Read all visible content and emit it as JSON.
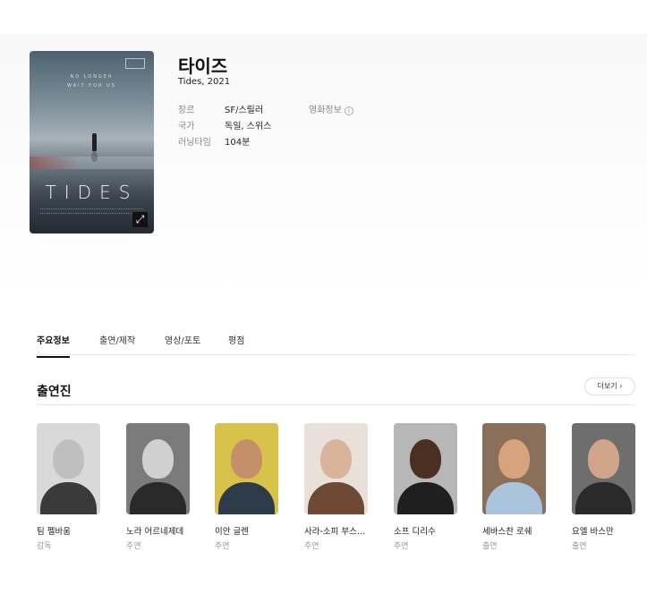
{
  "movie": {
    "title": "타이즈",
    "subtitle": "Tides, 2021",
    "poster": {
      "tagline_line1": "NO LONGER",
      "tagline_line2": "WAIT FOR US",
      "title_text": "TIDES",
      "expand_icon": "expand-icon"
    },
    "info": [
      {
        "key": "장르",
        "value": "SF/스릴러"
      },
      {
        "key": "국가",
        "value": "독일, 스위스"
      },
      {
        "key": "러닝타임",
        "value": "104분"
      }
    ],
    "more_info_label": "영화정보"
  },
  "tabs": [
    {
      "label": "주요정보",
      "active": true
    },
    {
      "label": "출연/제작",
      "active": false
    },
    {
      "label": "영상/포토",
      "active": false
    },
    {
      "label": "평점",
      "active": false
    }
  ],
  "cast_section": {
    "title": "출연진",
    "more_label": "더보기",
    "members": [
      {
        "name": "팀 펠바움",
        "role": "감독",
        "bg": "#d9d9d9",
        "skin": "#bfbfbf",
        "cloth": "#3a3a3a"
      },
      {
        "name": "노라 어르네제데",
        "role": "주연",
        "bg": "#7b7b7b",
        "skin": "#d0d0d0",
        "cloth": "#2a2a2a"
      },
      {
        "name": "이안 글렌",
        "role": "주연",
        "bg": "#d8c24a",
        "skin": "#c58f6a",
        "cloth": "#2d3b4a"
      },
      {
        "name": "사라-소피 부스니나",
        "role": "주연",
        "bg": "#e8e0d9",
        "skin": "#d9b49a",
        "cloth": "#6e4a34"
      },
      {
        "name": "소프 디리수",
        "role": "주연",
        "bg": "#b7b7b7",
        "skin": "#4b2f22",
        "cloth": "#1f1f1f"
      },
      {
        "name": "세바스찬 로쉐",
        "role": "출연",
        "bg": "#8a6f5a",
        "skin": "#d9a27e",
        "cloth": "#aac4dd"
      },
      {
        "name": "요엘 바스만",
        "role": "출연",
        "bg": "#6e6e6e",
        "skin": "#d2a58a",
        "cloth": "#2a2a2a"
      }
    ]
  }
}
